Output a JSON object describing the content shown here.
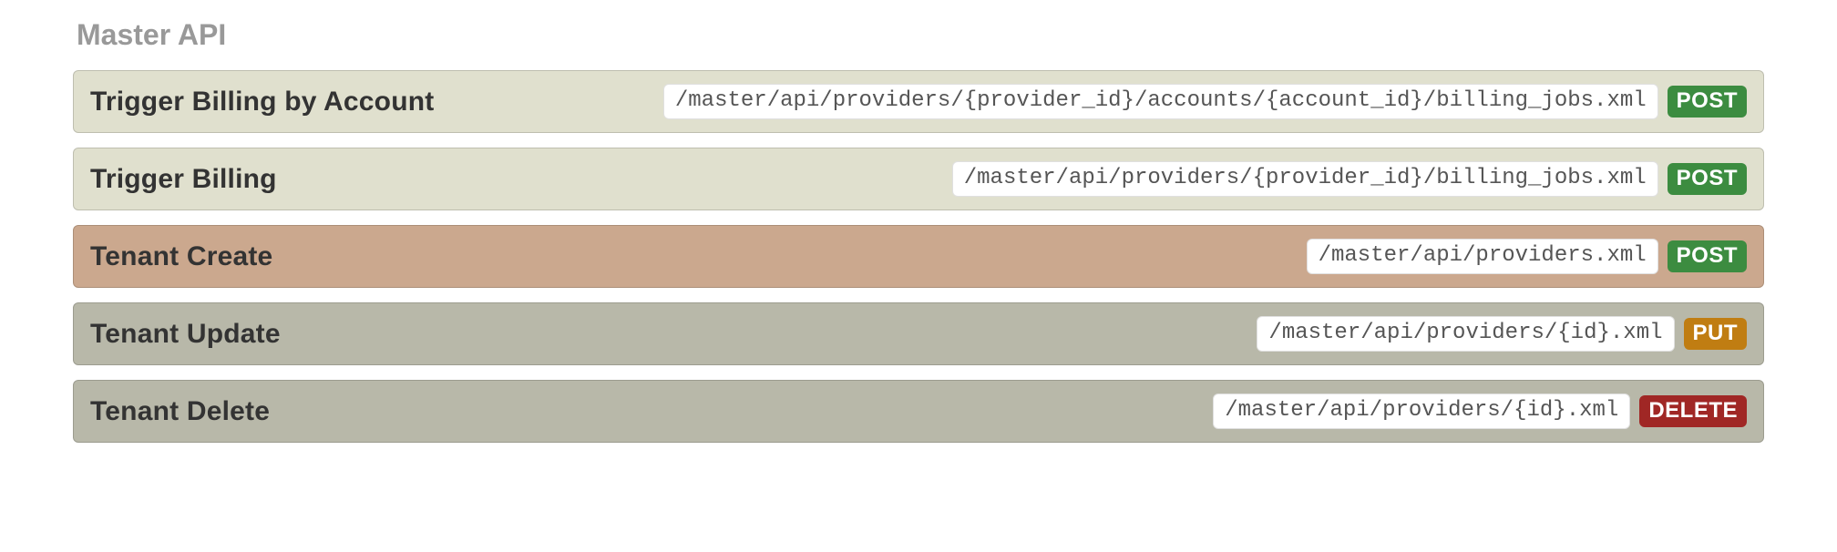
{
  "section": {
    "title": "Master API"
  },
  "endpoints": [
    {
      "name": "Trigger Billing by Account",
      "path": "/master/api/providers/{provider_id}/accounts/{account_id}/billing_jobs.xml",
      "method": "POST",
      "row_style": "tint-post",
      "method_style": "method-post"
    },
    {
      "name": "Trigger Billing",
      "path": "/master/api/providers/{provider_id}/billing_jobs.xml",
      "method": "POST",
      "row_style": "tint-post",
      "method_style": "method-post"
    },
    {
      "name": "Tenant Create",
      "path": "/master/api/providers.xml",
      "method": "POST",
      "row_style": "tint-active",
      "method_style": "method-post"
    },
    {
      "name": "Tenant Update",
      "path": "/master/api/providers/{id}.xml",
      "method": "PUT",
      "row_style": "tint-muted",
      "method_style": "method-put"
    },
    {
      "name": "Tenant Delete",
      "path": "/master/api/providers/{id}.xml",
      "method": "DELETE",
      "row_style": "tint-muted",
      "method_style": "method-delete"
    }
  ]
}
